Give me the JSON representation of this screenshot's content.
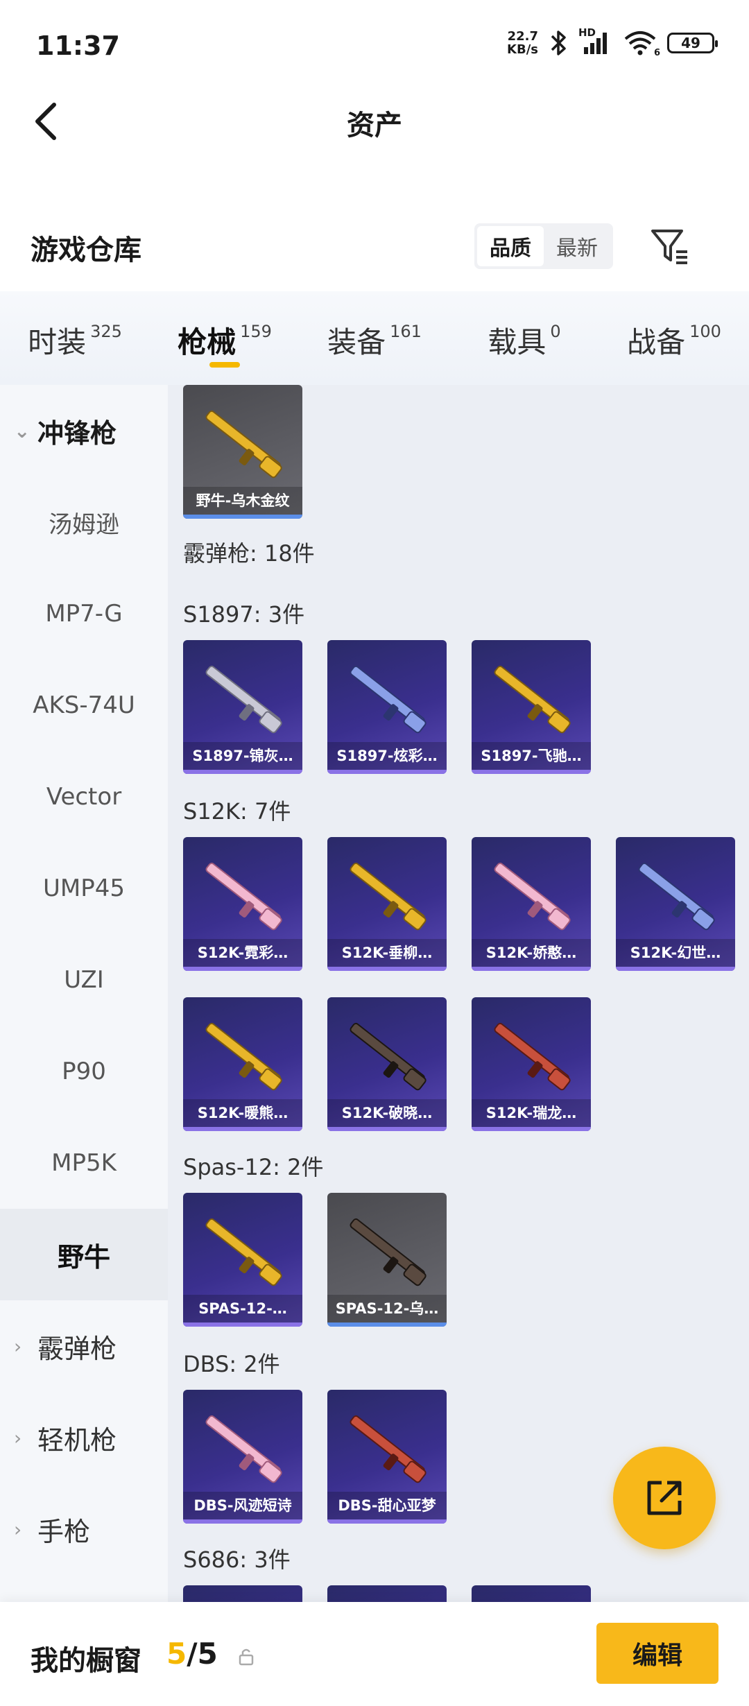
{
  "status_bar": {
    "time": "11:37",
    "net_speed_value": "22.7",
    "net_speed_unit": "KB/s",
    "hd_label": "HD",
    "wifi_sub": "6",
    "battery": "49"
  },
  "header": {
    "title": "资产"
  },
  "warehouse": {
    "title": "游戏仓库",
    "sort_options": [
      "品质",
      "最新"
    ],
    "sort_active": "品质"
  },
  "category_tabs": [
    {
      "label": "时装",
      "count": "325"
    },
    {
      "label": "枪械",
      "count": "159",
      "active": true
    },
    {
      "label": "装备",
      "count": "161"
    },
    {
      "label": "载具",
      "count": "0"
    },
    {
      "label": "战备",
      "count": "100"
    }
  ],
  "sidebar": [
    {
      "label": "冲锋枪",
      "type": "group",
      "open": true
    },
    {
      "label": "汤姆逊",
      "type": "item"
    },
    {
      "label": "MP7-G",
      "type": "item"
    },
    {
      "label": "AKS-74U",
      "type": "item"
    },
    {
      "label": "Vector",
      "type": "item"
    },
    {
      "label": "UMP45",
      "type": "item"
    },
    {
      "label": "UZI",
      "type": "item"
    },
    {
      "label": "P90",
      "type": "item"
    },
    {
      "label": "MP5K",
      "type": "item"
    },
    {
      "label": "野牛",
      "type": "item",
      "selected": true
    },
    {
      "label": "霰弹枪",
      "type": "group"
    },
    {
      "label": "轻机枪",
      "type": "group"
    },
    {
      "label": "手枪",
      "type": "group"
    }
  ],
  "content": {
    "top_item": {
      "name": "野牛-乌木金纹",
      "style": "gray",
      "gun": "gold"
    },
    "category_header": "霰弹枪: 18件",
    "groups": [
      {
        "header": "S1897: 3件",
        "items": [
          {
            "name": "S1897-锦灰…",
            "style": "purple",
            "gun": "silver"
          },
          {
            "name": "S1897-炫彩…",
            "style": "purple",
            "gun": "blue"
          },
          {
            "name": "S1897-飞驰…",
            "style": "purple",
            "gun": "gold"
          }
        ]
      },
      {
        "header": "S12K: 7件",
        "items": [
          {
            "name": "S12K-霓彩…",
            "style": "purple",
            "gun": "pink"
          },
          {
            "name": "S12K-垂柳…",
            "style": "purple",
            "gun": "gold"
          },
          {
            "name": "S12K-娇憨…",
            "style": "purple",
            "gun": "pink"
          },
          {
            "name": "S12K-幻世…",
            "style": "purple",
            "gun": "blue"
          },
          {
            "name": "S12K-暖熊…",
            "style": "purple",
            "gun": "gold"
          },
          {
            "name": "S12K-破晓…",
            "style": "purple",
            "gun": "dark"
          },
          {
            "name": "S12K-瑞龙…",
            "style": "purple",
            "gun": "red"
          }
        ]
      },
      {
        "header": "Spas-12: 2件",
        "items": [
          {
            "name": "SPAS-12-…",
            "style": "purple",
            "gun": "gold"
          },
          {
            "name": "SPAS-12-乌…",
            "style": "gray",
            "gun": "dark"
          }
        ]
      },
      {
        "header": "DBS: 2件",
        "items": [
          {
            "name": "DBS-风迹短诗",
            "style": "purple",
            "gun": "pink"
          },
          {
            "name": "DBS-甜心亚梦",
            "style": "purple",
            "gun": "red"
          }
        ]
      },
      {
        "header": "S686: 3件",
        "items": []
      }
    ]
  },
  "bottom_bar": {
    "label": "我的橱窗",
    "current": "5",
    "separator": "/",
    "total": "5",
    "edit_label": "编辑"
  },
  "colors": {
    "accent": "#f8b81a",
    "card_purple": "#3a2f8e",
    "card_gray": "#5a5a60"
  }
}
